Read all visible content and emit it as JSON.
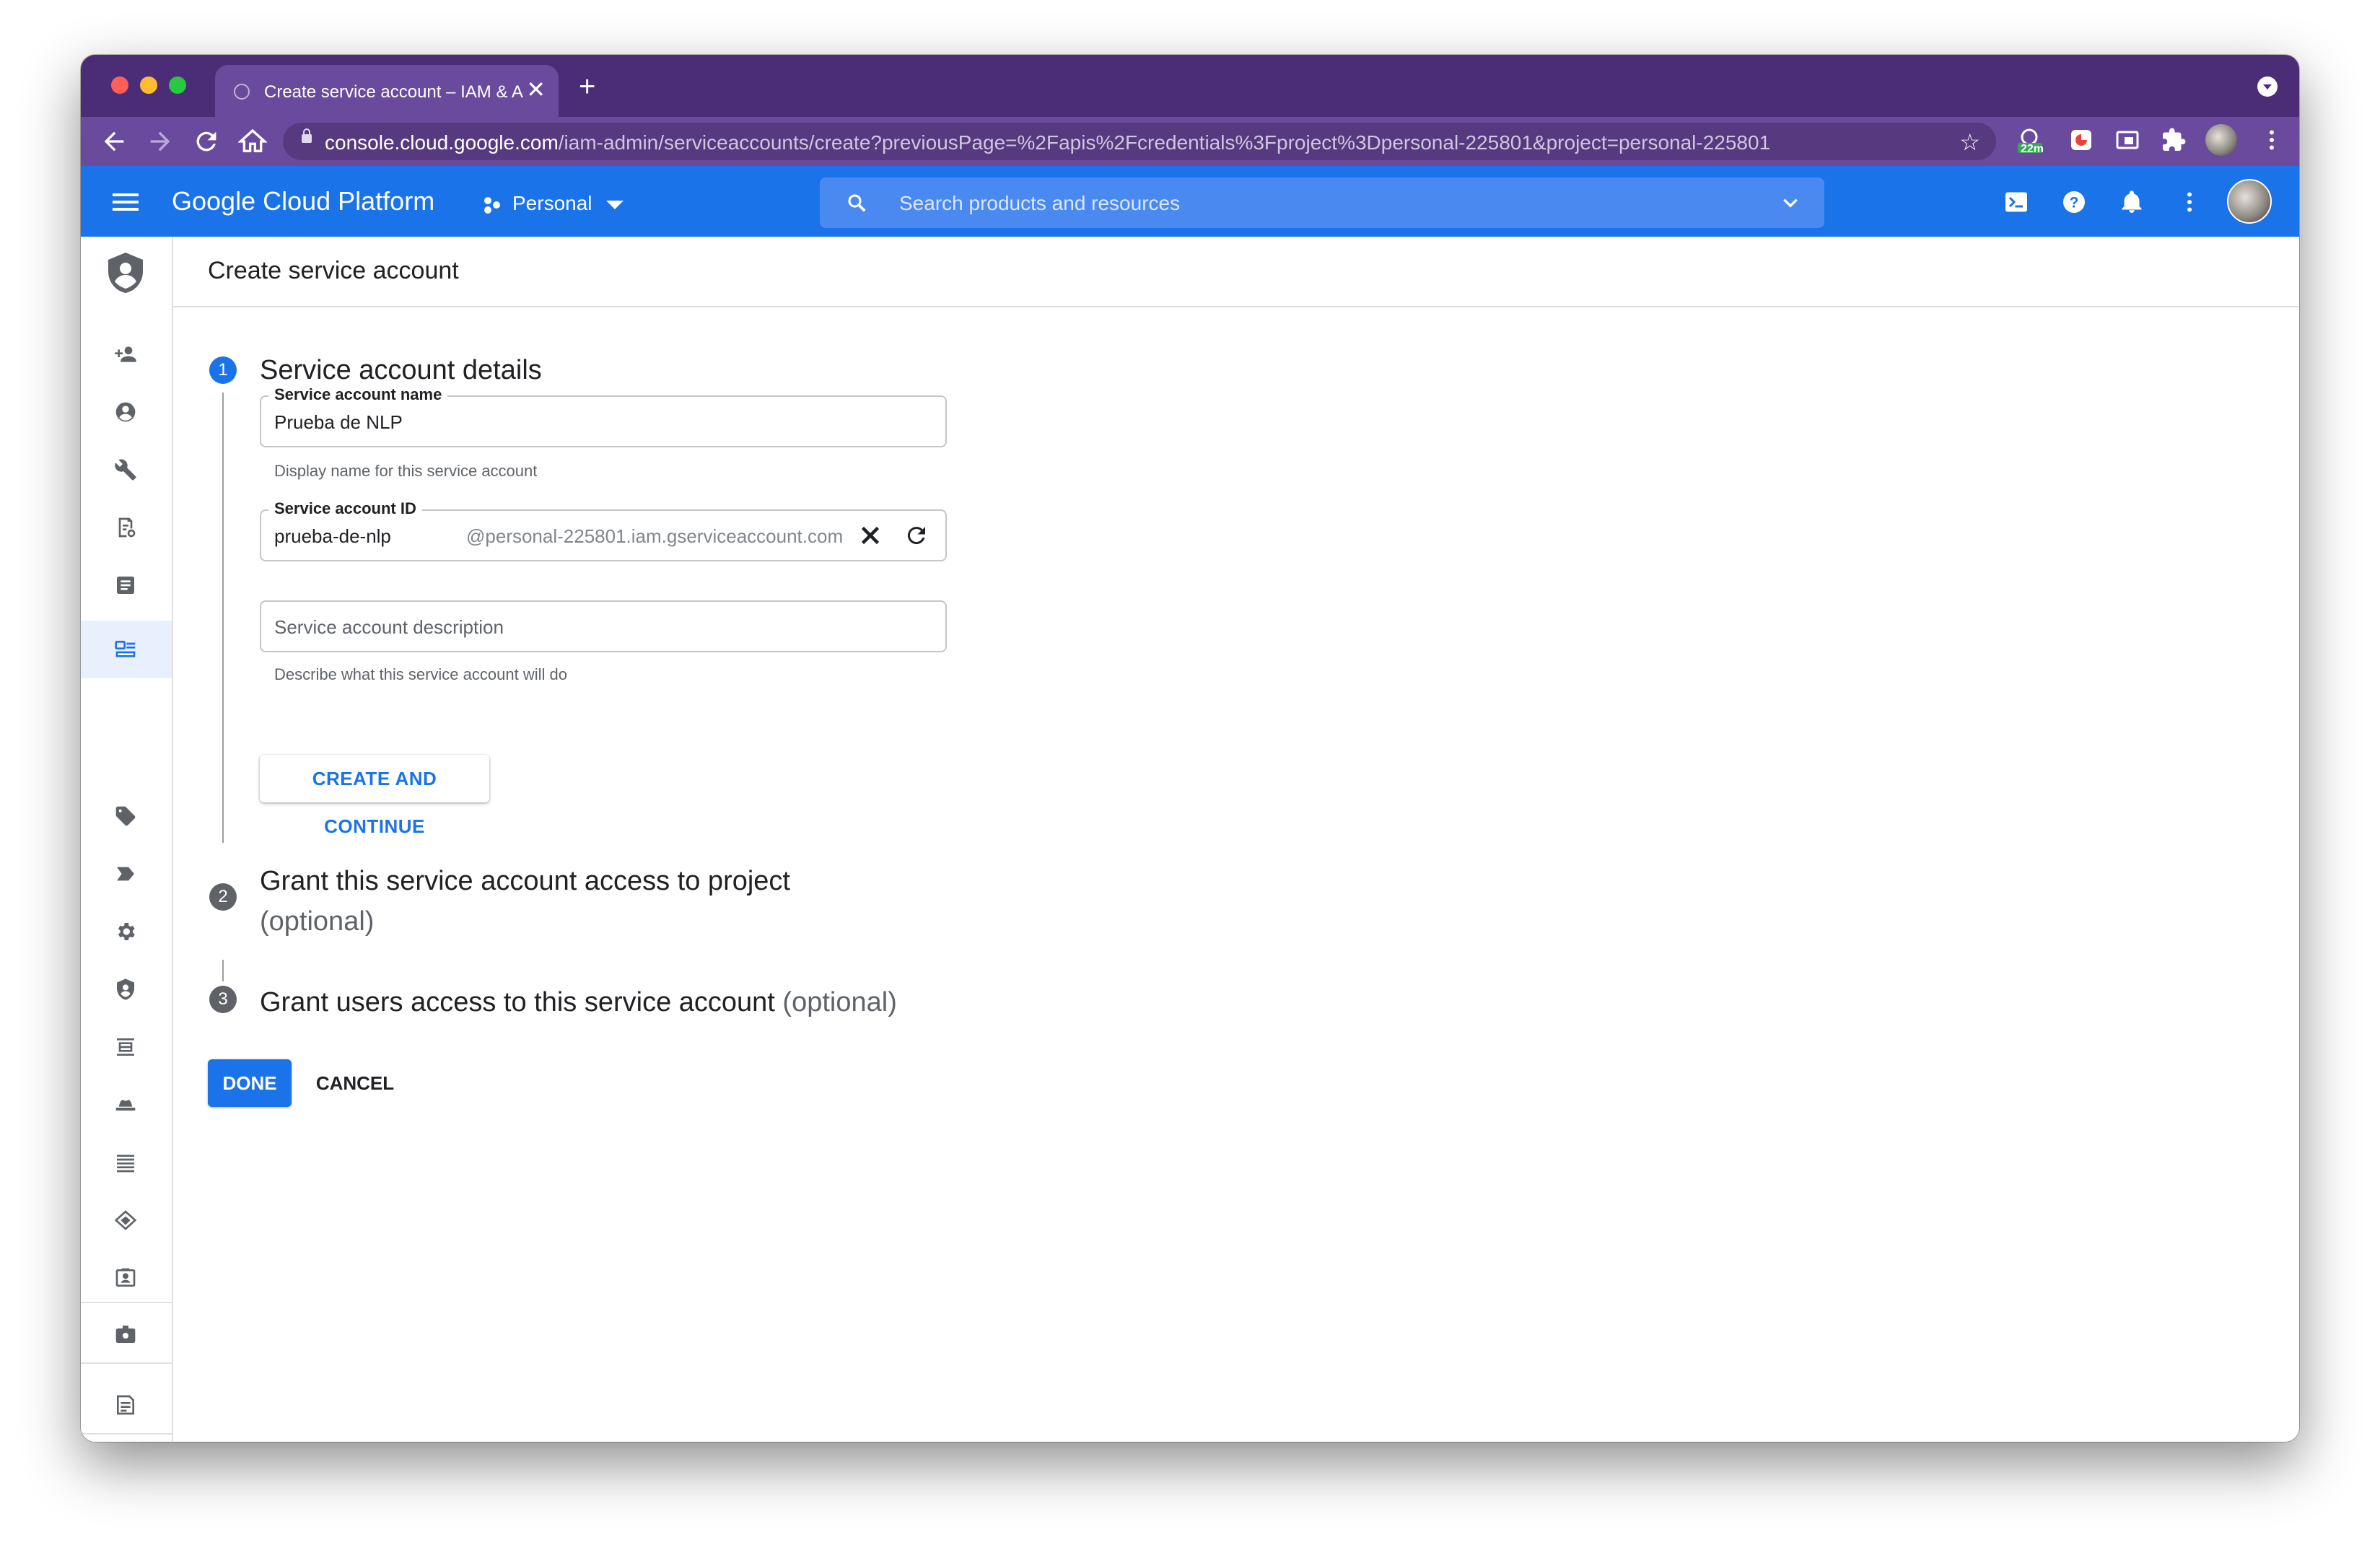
{
  "browser": {
    "tab_title": "Create service account – IAM & Admin",
    "tab_close": "✕",
    "new_tab": "+",
    "url_host": "console.cloud.google.com",
    "url_path": "/iam-admin/serviceaccounts/create?previousPage=%2Fapis%2Fcredentials%3Fproject%3Dpersonal-225801&project=personal-225801",
    "extension_badge": "22m",
    "colors": {
      "frame": "#4b2c77",
      "toolbar": "#6a4a9c"
    }
  },
  "gcp_header": {
    "brand": "Google Cloud Platform",
    "project": "Personal",
    "search_placeholder": "Search products and resources",
    "color": "#1a73e8"
  },
  "sidenav": {
    "items": [
      "shield-logo",
      "add-person",
      "account-circle",
      "wrench",
      "receipt",
      "article",
      "service-accounts",
      "tag",
      "label",
      "settings",
      "security",
      "list-alt",
      "spy",
      "list",
      "diamond",
      "identity",
      "settings-box",
      "audit-log",
      "expand"
    ],
    "active": "service-accounts"
  },
  "page": {
    "title": "Create service account"
  },
  "steps": [
    {
      "number": "1",
      "title": "Service account details",
      "optional": ""
    },
    {
      "number": "2",
      "title": "Grant this service account access to project",
      "optional": "(optional)"
    },
    {
      "number": "3",
      "title": "Grant users access to this service account",
      "optional": "(optional)"
    }
  ],
  "form": {
    "name_label": "Service account name",
    "name_value": "Prueba de NLP",
    "name_hint": "Display name for this service account",
    "id_label": "Service account ID",
    "id_value": "prueba-de-nlp",
    "id_suffix": "@personal-225801.iam.gserviceaccount.com",
    "description_placeholder": "Service account description",
    "description_hint": "Describe what this service account will do",
    "create_button": "CREATE AND CONTINUE"
  },
  "actions": {
    "done": "DONE",
    "cancel": "CANCEL"
  }
}
